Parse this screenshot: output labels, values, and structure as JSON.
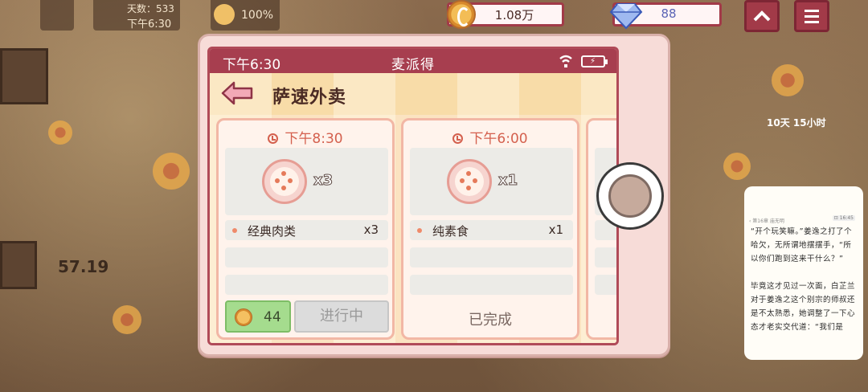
{
  "hud": {
    "days_label": "天数：533",
    "clock_label": "下午6:30",
    "happiness": "100%",
    "coins": "1.08万",
    "gems": "88"
  },
  "scene": {
    "timer_text": "57.19",
    "right_label": "10天 15小时"
  },
  "phone": {
    "status_time": "下午6:30",
    "app_name": "麦派得",
    "page_title": "萨速外卖",
    "orders": [
      {
        "time": "下午8:30",
        "food_count": "x3",
        "items": [
          {
            "name": "经典肉类",
            "qty": "x3"
          }
        ],
        "reward": "44",
        "status": "进行中"
      },
      {
        "time": "下午6:00",
        "food_count": "x1",
        "items": [
          {
            "name": "纯素食",
            "qty": "x1"
          }
        ],
        "status": "已完成"
      }
    ]
  },
  "novel": {
    "header": "‹ 第16章 庙无明",
    "badge": "⊡ 16:45",
    "paragraph1": "“开个玩笑嘛。”姜逸之打了个哈欠，无所谓地摆摆手，“所以你们跑到这来干什么？”",
    "paragraph2": "毕竟这才见过一次面，白芷兰对于姜逸之这个别宗的师叔还是不太熟悉，她调整了一下心态才老实交代道：“我们是"
  },
  "colors": {
    "accent": "#a73e4f",
    "header_stripe": "#fbe8c4",
    "reward_green": "#a5dc8e",
    "time_red": "#d4604e"
  },
  "icons": [
    "clock-icon",
    "wifi-icon",
    "battery-icon",
    "back-arrow-icon",
    "coin-icon",
    "gem-icon",
    "menu-icon",
    "up-arrow-icon"
  ]
}
